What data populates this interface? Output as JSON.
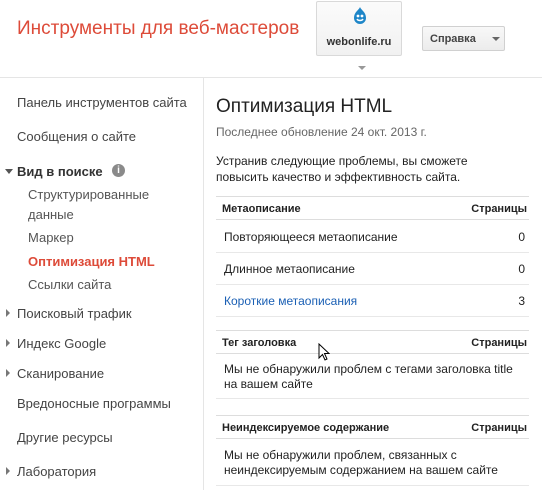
{
  "header": {
    "app_title": "Инструменты для веб-мастеров",
    "site": "webonlife.ru",
    "help_label": "Справка"
  },
  "sidebar": {
    "items": [
      {
        "label": "Панель инструментов сайта"
      },
      {
        "label": "Сообщения о сайте"
      },
      {
        "label": "Вид в поиске"
      },
      {
        "label": "Структурированные"
      },
      {
        "label": "данные"
      },
      {
        "label": "Маркер"
      },
      {
        "label": "Оптимизация HTML"
      },
      {
        "label": "Ссылки сайта"
      },
      {
        "label": "Поисковый трафик"
      },
      {
        "label": "Индекс Google"
      },
      {
        "label": "Сканирование"
      },
      {
        "label": "Вредоносные программы"
      },
      {
        "label": "Другие ресурсы"
      },
      {
        "label": "Лаборатория"
      }
    ],
    "info_glyph": "i"
  },
  "main": {
    "title": "Оптимизация HTML",
    "updated": "Последнее обновление 24 окт. 2013 г.",
    "intro": "Устранив следующие проблемы, вы сможете повысить качество и эффективность сайта.",
    "sections": [
      {
        "header": "Метаописание",
        "pages_header": "Страницы",
        "rows": [
          {
            "label": "Повторяющееся метаописание",
            "count": "0"
          },
          {
            "label": "Длинное метаописание",
            "count": "0"
          },
          {
            "label": "Короткие метаописания",
            "count": "3"
          }
        ]
      },
      {
        "header": "Тег заголовка",
        "pages_header": "Страницы",
        "message": "Мы не обнаружили проблем с тегами заголовка title на вашем сайте"
      },
      {
        "header": "Неиндексируемое содержание",
        "pages_header": "Страницы",
        "message": "Мы не обнаружили проблем, связанных с неиндексируемым содержанием на вашем сайте"
      }
    ]
  },
  "colors": {
    "accent": "#dd4b39",
    "link": "#1a5fb4"
  },
  "icons": [
    "drupal-icon",
    "caret-down-icon",
    "info-icon",
    "expand-arrow-icon",
    "mouse-cursor-icon"
  ]
}
